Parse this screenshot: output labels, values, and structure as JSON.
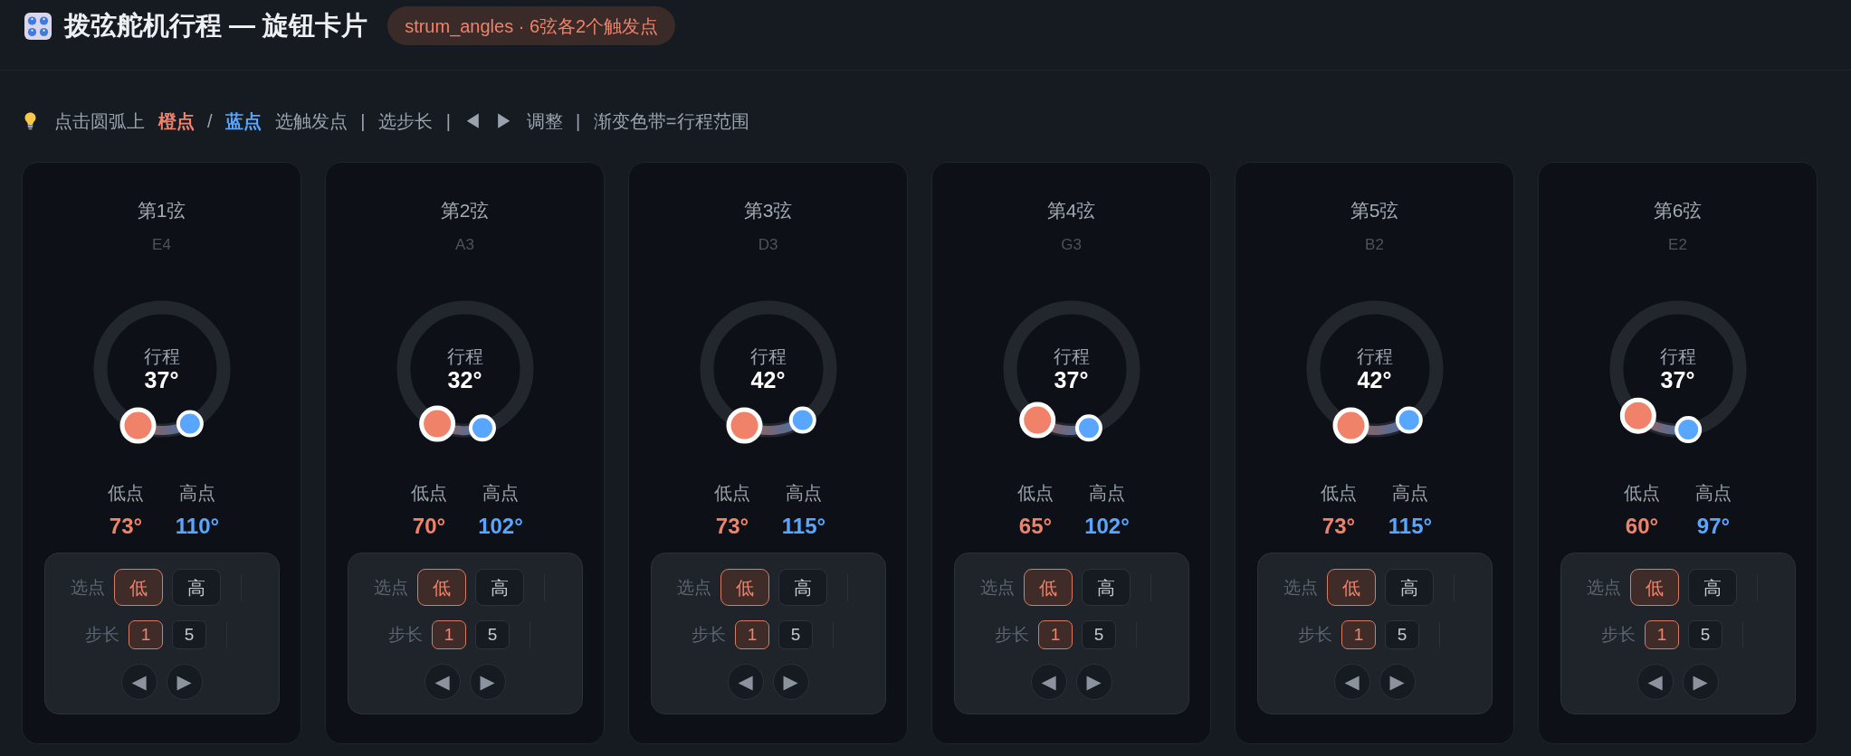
{
  "header": {
    "title": "拨弦舵机行程 — 旋钮卡片",
    "badge": "strum_angles · 6弦各2个触发点"
  },
  "hint": "点击圆弧上 **橙点** / **蓝点** 选触发点 | 选步长 | ◀ ▶ 调整 | 渐变色带=行程范围",
  "strings": [
    {
      "title": "第1弦",
      "note": "E4",
      "travel": {
        "label": "行程",
        "value": "37°"
      },
      "low": {
        "label": "低点",
        "value": "73°"
      },
      "high": {
        "label": "高点",
        "value": "110°"
      },
      "point_picker": {
        "label": "选点",
        "options": [
          {
            "label": "低",
            "selected": true
          },
          {
            "label": "高",
            "selected": false
          }
        ]
      },
      "step_picker": {
        "label": "步长",
        "options": [
          {
            "label": "1",
            "selected": true
          },
          {
            "label": "5",
            "selected": false
          }
        ]
      },
      "nudge_buttons": [
        "◀",
        "▶"
      ]
    },
    {
      "title": "第2弦",
      "note": "A3",
      "travel": {
        "label": "行程",
        "value": "32°"
      },
      "low": {
        "label": "低点",
        "value": "70°"
      },
      "high": {
        "label": "高点",
        "value": "102°"
      },
      "point_picker": {
        "label": "选点",
        "options": [
          {
            "label": "低",
            "selected": true
          },
          {
            "label": "高",
            "selected": false
          }
        ]
      },
      "step_picker": {
        "label": "步长",
        "options": [
          {
            "label": "1",
            "selected": true
          },
          {
            "label": "5",
            "selected": false
          }
        ]
      },
      "nudge_buttons": [
        "◀",
        "▶"
      ]
    },
    {
      "title": "第3弦",
      "note": "D3",
      "travel": {
        "label": "行程",
        "value": "42°"
      },
      "low": {
        "label": "低点",
        "value": "73°"
      },
      "high": {
        "label": "高点",
        "value": "115°"
      },
      "point_picker": {
        "label": "选点",
        "options": [
          {
            "label": "低",
            "selected": true
          },
          {
            "label": "高",
            "selected": false
          }
        ]
      },
      "step_picker": {
        "label": "步长",
        "options": [
          {
            "label": "1",
            "selected": true
          },
          {
            "label": "5",
            "selected": false
          }
        ]
      },
      "nudge_buttons": [
        "◀",
        "▶"
      ]
    },
    {
      "title": "第4弦",
      "note": "G3",
      "travel": {
        "label": "行程",
        "value": "37°"
      },
      "low": {
        "label": "低点",
        "value": "65°"
      },
      "high": {
        "label": "高点",
        "value": "102°"
      },
      "point_picker": {
        "label": "选点",
        "options": [
          {
            "label": "低",
            "selected": true
          },
          {
            "label": "高",
            "selected": false
          }
        ]
      },
      "step_picker": {
        "label": "步长",
        "options": [
          {
            "label": "1",
            "selected": true
          },
          {
            "label": "5",
            "selected": false
          }
        ]
      },
      "nudge_buttons": [
        "◀",
        "▶"
      ]
    },
    {
      "title": "第5弦",
      "note": "B2",
      "travel": {
        "label": "行程",
        "value": "42°"
      },
      "low": {
        "label": "低点",
        "value": "73°"
      },
      "high": {
        "label": "高点",
        "value": "115°"
      },
      "point_picker": {
        "label": "选点",
        "options": [
          {
            "label": "低",
            "selected": true
          },
          {
            "label": "高",
            "selected": false
          }
        ]
      },
      "step_picker": {
        "label": "步长",
        "options": [
          {
            "label": "1",
            "selected": true
          },
          {
            "label": "5",
            "selected": false
          }
        ]
      },
      "nudge_buttons": [
        "◀",
        "▶"
      ]
    },
    {
      "title": "第6弦",
      "note": "E2",
      "travel": {
        "label": "行程",
        "value": "37°"
      },
      "low": {
        "label": "低点",
        "value": "60°"
      },
      "high": {
        "label": "高点",
        "value": "97°"
      },
      "point_picker": {
        "label": "选点",
        "options": [
          {
            "label": "低",
            "selected": true
          },
          {
            "label": "高",
            "selected": false
          }
        ]
      },
      "step_picker": {
        "label": "步长",
        "options": [
          {
            "label": "1",
            "selected": true
          },
          {
            "label": "5",
            "selected": false
          }
        ]
      },
      "nudge_buttons": [
        "◀",
        "▶"
      ]
    }
  ]
}
